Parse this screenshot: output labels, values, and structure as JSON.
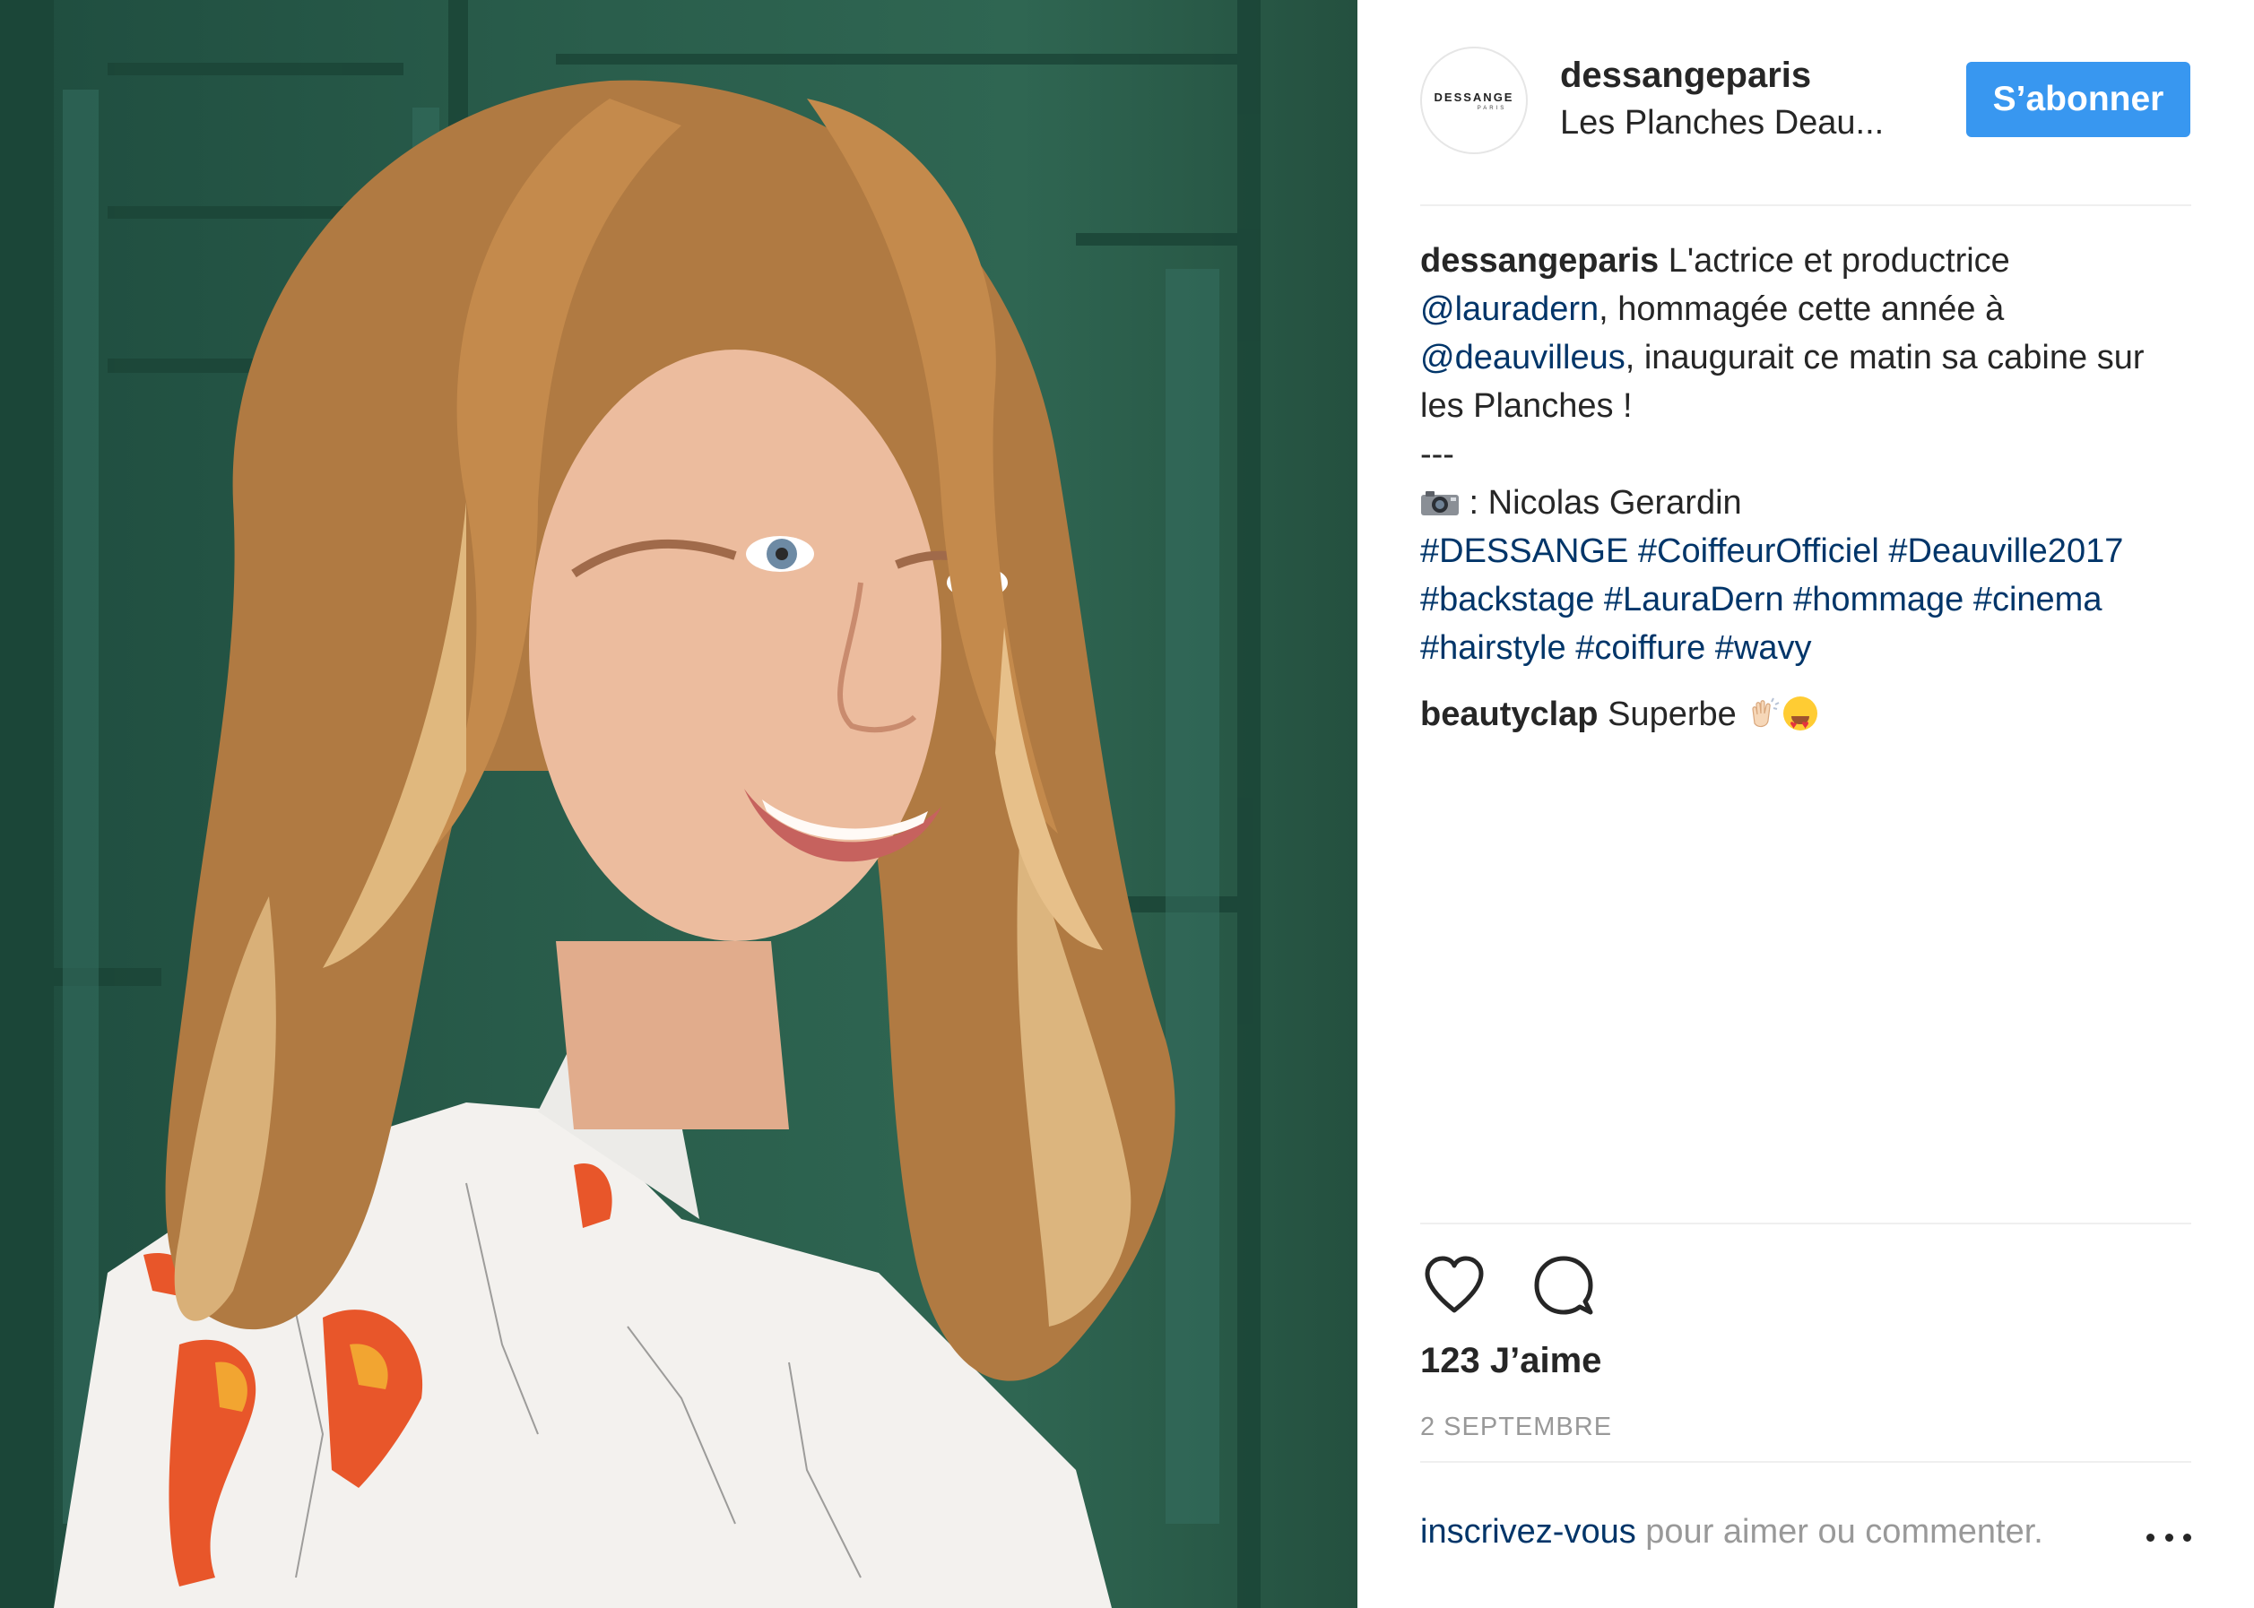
{
  "header": {
    "avatar_brand": "DESSANGE",
    "avatar_sub": "PARIS",
    "username": "dessangeparis",
    "location": "Les Planches Deau...",
    "follow_label": "S’abonner"
  },
  "caption": {
    "author": "dessangeparis",
    "line1_text": " L'actrice et productrice",
    "mention1": "@lauradern",
    "line2_text": ", hommagée cette année à",
    "mention2": "@deauvilleus",
    "line3_text": ", inaugurait ce matin sa cabine sur",
    "line4_text": "les Planches !",
    "separator": "---",
    "credit_text": " : Nicolas Gerardin",
    "hashtags_line1": "#DESSANGE #CoiffeurOfficiel #Deauville2017",
    "hashtags_line2": "#backstage #LauraDern #hommage #cinema",
    "hashtags_line3": "#hairstyle #coiffure #wavy"
  },
  "comment": {
    "author": "beautyclap",
    "text": " Superbe "
  },
  "icons": {
    "like": "heart-icon",
    "comment": "comment-bubble-icon",
    "camera": "camera-emoji",
    "clap": "clapping-hands-emoji",
    "heart_eyes": "heart-eyes-emoji",
    "more": "more-options-icon"
  },
  "stats": {
    "likes": "123 J’aime",
    "date": "2 SEPTEMBRE"
  },
  "footer": {
    "signup_link": "inscrivez-vous",
    "signup_text": " pour aimer ou commenter."
  },
  "colors": {
    "accent": "#3897f0",
    "link": "#003569",
    "muted": "#999999",
    "text": "#262626",
    "divider": "#efefef",
    "photo_background": "#2a5e4c"
  }
}
